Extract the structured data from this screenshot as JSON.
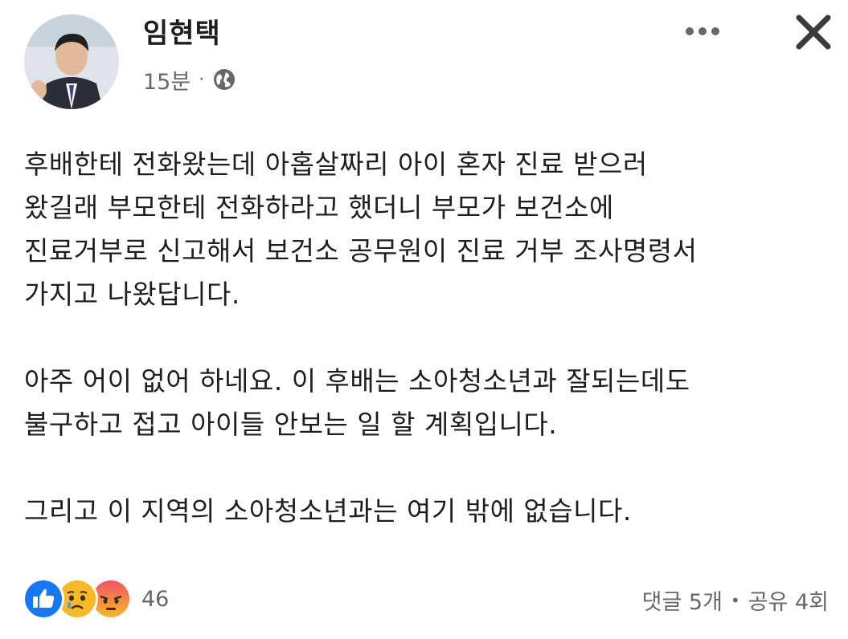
{
  "post": {
    "author": "임현택",
    "time": "15분",
    "separator": "·",
    "privacy_icon": "globe-icon",
    "body_paragraphs": [
      [
        "후배한테 전화왔는데 아홉살짜리 아이 혼자 진료 받으러",
        "왔길래 부모한테 전화하라고 했더니 부모가 보건소에",
        "진료거부로 신고해서 보건소 공무원이 진료 거부 조사명령서",
        "가지고 나왔답니다."
      ],
      [
        "아주 어이 없어 하네요. 이 후배는 소아청소년과 잘되는데도",
        "불구하고 접고 아이들 안보는 일 할 계획입니다."
      ],
      [
        "그리고 이 지역의 소아청소년과는 여기 밖에 없습니다."
      ]
    ]
  },
  "header_actions": {
    "more_icon": "more-horizontal-icon",
    "close_icon": "close-icon"
  },
  "reactions": {
    "icons": [
      "like-icon",
      "sad-icon",
      "angry-icon"
    ],
    "count": "46"
  },
  "stats": {
    "comments": "댓글 5개",
    "dot": "•",
    "shares": "공유 4회"
  },
  "colors": {
    "like": "#1877f2",
    "sad": "#f7b928",
    "angry": "#f25268",
    "secondary_text": "#65676b"
  }
}
